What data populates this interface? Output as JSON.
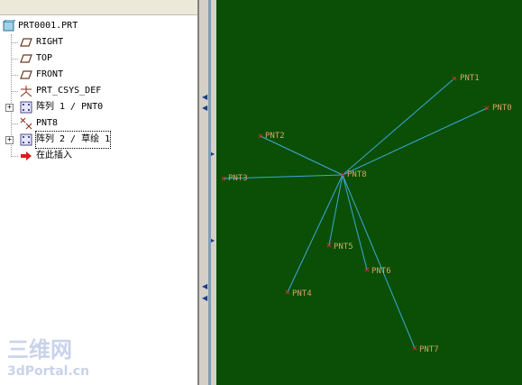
{
  "tree": {
    "root": "PRT0001.PRT",
    "items": [
      {
        "label": "RIGHT",
        "icon": "datum-plane-icon",
        "expandable": false
      },
      {
        "label": "TOP",
        "icon": "datum-plane-icon",
        "expandable": false
      },
      {
        "label": "FRONT",
        "icon": "datum-plane-icon",
        "expandable": false
      },
      {
        "label": "PRT_CSYS_DEF",
        "icon": "coordinate-system-icon",
        "expandable": false
      },
      {
        "label": "阵列 1 / PNT0",
        "icon": "pattern-icon",
        "expandable": true
      },
      {
        "label": "PNT8",
        "icon": "datum-point-icon",
        "expandable": false
      },
      {
        "label": "阵列 2 / 草绘 1",
        "icon": "pattern-icon",
        "expandable": true,
        "selected": true
      },
      {
        "label": "在此插入",
        "icon": "insert-here-arrow-icon",
        "expandable": false
      }
    ]
  },
  "watermark": {
    "line1": "三维网",
    "line2": "3dPortal.cn"
  },
  "viewport": {
    "background": "#0a4f05",
    "line_color": "#3fa7d6",
    "label_color": "#d7a36b",
    "center": "PNT8",
    "points": [
      "PNT1",
      "PNT0",
      "PNT2",
      "PNT3",
      "PNT8",
      "PNT5",
      "PNT6",
      "PNT4",
      "PNT7"
    ]
  }
}
